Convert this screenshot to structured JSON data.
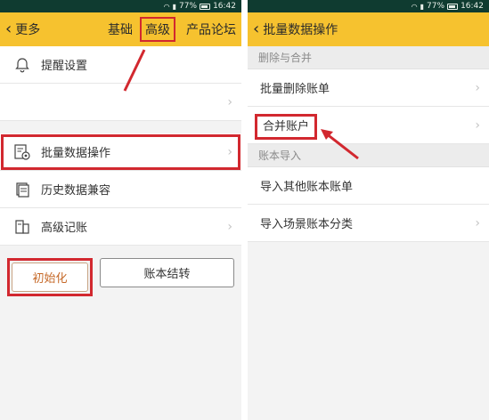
{
  "status": {
    "battery_pct": "77%",
    "time": "16:42"
  },
  "left": {
    "nav": {
      "back_label": "更多",
      "tabs": [
        "基础",
        "高级",
        "产品论坛"
      ],
      "active_tab": "高级"
    },
    "items": [
      {
        "label": "提醒设置",
        "icon": "bell-icon",
        "has_arrow": false
      },
      {
        "label": "",
        "icon": "",
        "has_arrow": true
      },
      {
        "label": "批量数据操作",
        "icon": "batch-settings-icon",
        "has_arrow": true
      },
      {
        "label": "历史数据兼容",
        "icon": "document-stack-icon",
        "has_arrow": false
      },
      {
        "label": "高级记账",
        "icon": "ledger-book-icon",
        "has_arrow": true
      }
    ],
    "buttons": {
      "init_label": "初始化",
      "close_label": "账本结转"
    }
  },
  "right": {
    "nav": {
      "title": "批量数据操作"
    },
    "sections": [
      {
        "header": "删除与合并",
        "items": [
          "批量删除账单",
          "合并账户"
        ]
      },
      {
        "header": "账本导入",
        "items": [
          "导入其他账本账单",
          "导入场景账本分类"
        ]
      }
    ]
  },
  "colors": {
    "accent_yellow": "#f6c22f",
    "highlight_red": "#d2282f",
    "statusbar": "#0f3b30"
  }
}
